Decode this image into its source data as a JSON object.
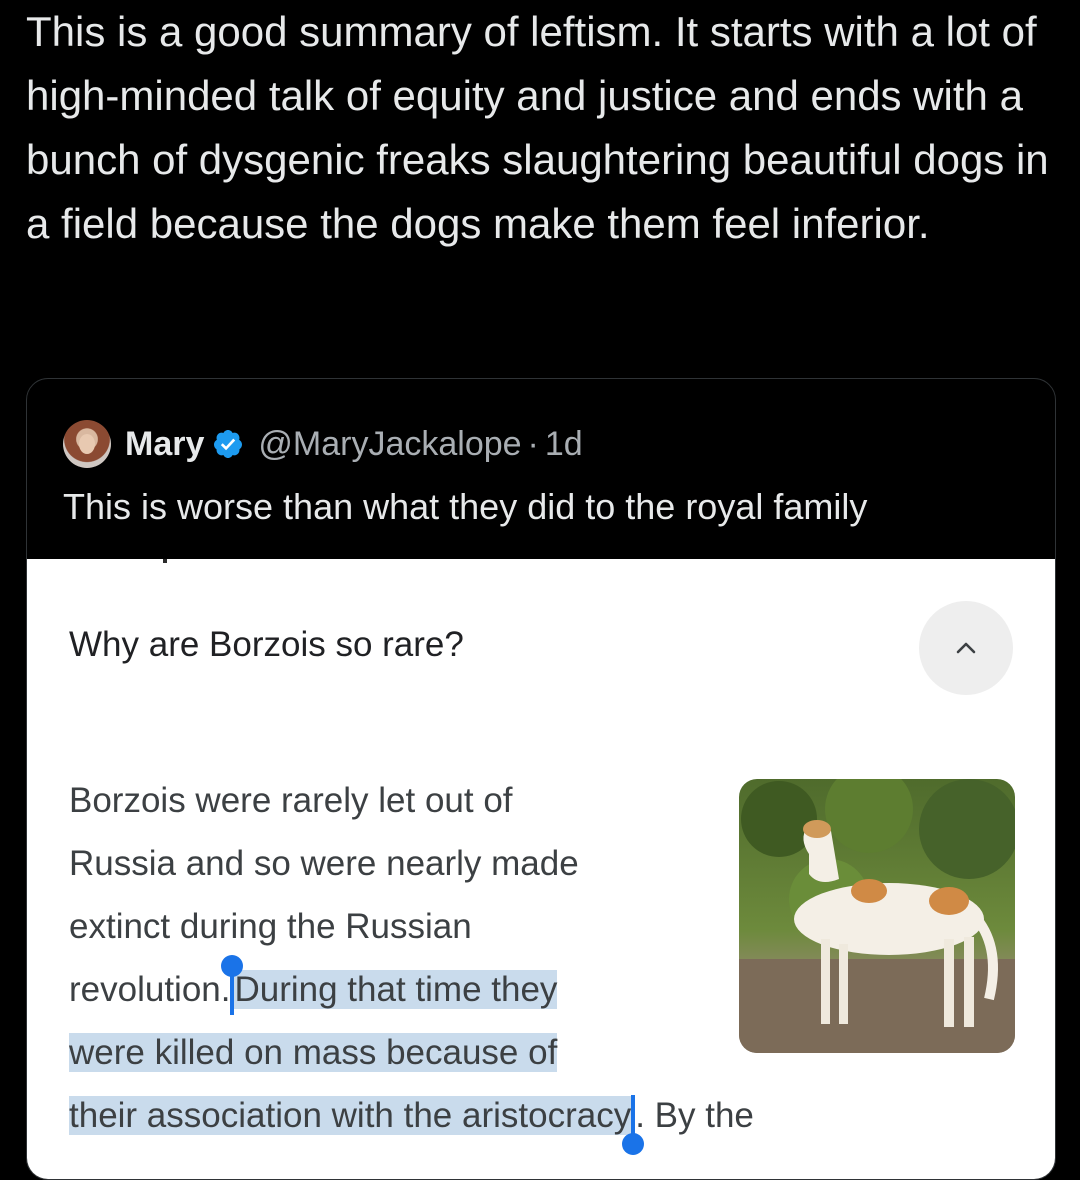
{
  "tweet": {
    "text": "This is a good summary of leftism. It starts with a lot of high-minded talk of equity and justice and ends with a bunch of dysgenic freaks slaughtering beautiful dogs in a field because the dogs make them feel inferior."
  },
  "quoted_tweet": {
    "name": "Mary",
    "handle": "@MaryJackalope",
    "separator": "·",
    "time": "1d",
    "text": "This is worse than what they did to the royal family",
    "verified_icon": "verified-badge-icon"
  },
  "embedded_screenshot": {
    "question": "Why are Borzois so rare?",
    "collapse_icon": "chevron-up-icon",
    "answer_lines": [
      "Borzois were rarely let out of",
      "Russia and so were nearly made",
      "extinct during the Russian",
      "revolution.",
      "During that time they",
      "were killed on mass because of",
      "their association with the aristocracy",
      "By the"
    ],
    "answer_punct": ".",
    "image_icon": "borzoi-dog-image",
    "highlight_color": "#c9dbec",
    "selection_handle_color": "#1a73e8"
  }
}
